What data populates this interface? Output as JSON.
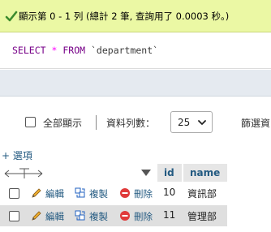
{
  "status": {
    "message": "顯示第 0 - 1 列 (總計 2 筆, 查詢用了 0.0003 秒。)"
  },
  "query": {
    "select_kw": "SELECT",
    "star": "*",
    "from_kw": "FROM",
    "table": "`department`"
  },
  "controls": {
    "show_all_label": "全部顯示",
    "rows_label": "資料列數：",
    "rows_value": "25",
    "filter_label": "篩選資"
  },
  "options_link": "+ 選項",
  "table": {
    "columns": [
      "id",
      "name"
    ],
    "actions": {
      "edit": "編輯",
      "copy": "複製",
      "delete": "刪除"
    },
    "rows": [
      {
        "id": "10",
        "name": "資訊部"
      },
      {
        "id": "11",
        "name": "管理部"
      }
    ]
  },
  "colors": {
    "success_bg": "#ebf8a4",
    "link": "#235a81",
    "keyword": "#770088",
    "operator": "#ff00ff"
  },
  "icons": [
    "check-icon",
    "column-arrows-icon",
    "sort-desc-icon",
    "pencil-icon",
    "copy-icon",
    "delete-icon",
    "chevron-down-icon"
  ]
}
